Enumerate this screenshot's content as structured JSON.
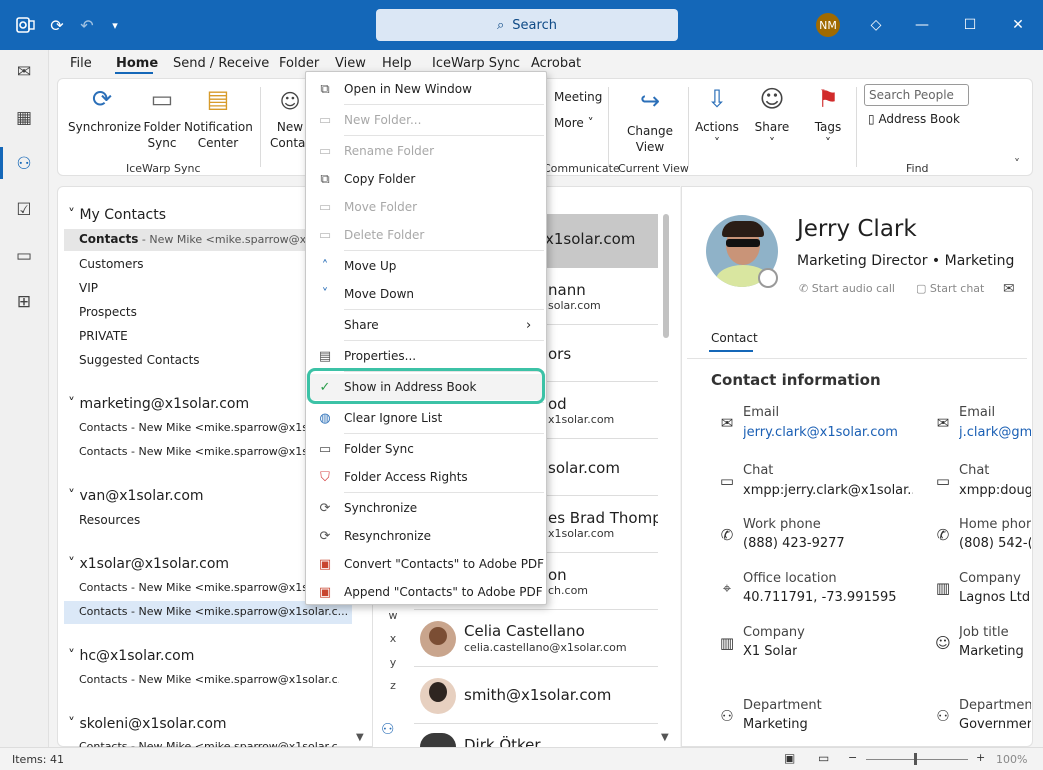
{
  "titlebar": {
    "search_placeholder": "Search",
    "user_initials": "NM"
  },
  "tabs": [
    "File",
    "Home",
    "Send / Receive",
    "Folder",
    "View",
    "Help",
    "IceWarp Sync",
    "Acrobat"
  ],
  "ribbon": {
    "synchronize": "Synchronize",
    "folder_sync_1": "Folder",
    "folder_sync_2": "Sync",
    "notif_1": "Notification",
    "notif_2": "Center",
    "icewarp_group": "IceWarp Sync",
    "new_contact_1": "New",
    "new_contact_2": "Contact",
    "meeting": "Meeting",
    "more": "More",
    "communicate": "Communicate",
    "change_view_1": "Change",
    "change_view_2": "View",
    "current_view": "Current View",
    "actions": "Actions",
    "share": "Share",
    "tags": "Tags",
    "search_people": "Search People",
    "address_book": "Address Book",
    "find": "Find"
  },
  "nav": {
    "my_contacts": "My Contacts",
    "items": [
      {
        "name": "Contacts",
        "sub": " - New Mike <mike.sparrow@x1solar.com>"
      },
      {
        "name": "Customers"
      },
      {
        "name": "VIP"
      },
      {
        "name": "Prospects"
      },
      {
        "name": "PRIVATE"
      },
      {
        "name": "Suggested Contacts"
      }
    ],
    "acct1": "marketing@x1solar.com",
    "acct1_items": [
      "Contacts - New Mike <mike.sparrow@x1solar.c...",
      "Contacts - New Mike <mike.sparrow@x1solar.c..."
    ],
    "acct2": "van@x1solar.com",
    "acct2_items": [
      "Resources"
    ],
    "acct3": "x1solar@x1solar.com",
    "acct3_items": [
      "Contacts - New Mike <mike.sparrow@x1solar.c...",
      "Contacts - New Mike <mike.sparrow@x1solar.c..."
    ],
    "acct4": "hc@x1solar.com",
    "acct4_items": [
      "Contacts - New Mike <mike.sparrow@x1solar.c..."
    ],
    "acct5": "skoleni@x1solar.com",
    "acct5_items": [
      "Contacts - New Mike <mike.sparrow@x1solar.c..."
    ]
  },
  "list": {
    "rows": [
      {
        "name": "x1solar.com",
        "mail": ""
      },
      {
        "name": "nann",
        "mail": "solar.com"
      },
      {
        "name": "ors",
        "mail": ""
      },
      {
        "name": "od",
        "mail": "x1solar.com"
      },
      {
        "name": "solar.com",
        "mail": ""
      },
      {
        "name": "es Brad Thomp...",
        "mail": "x1solar.com"
      },
      {
        "name": "on",
        "mail": "ch.com"
      },
      {
        "name": "Celia Castellano",
        "mail": "celia.castellano@x1solar.com"
      },
      {
        "name": "smith@x1solar.com",
        "mail": ""
      },
      {
        "name": "Dirk Ötker",
        "mail": ""
      }
    ],
    "alpha": [
      "w",
      "x",
      "y",
      "z"
    ]
  },
  "contact": {
    "name": "Jerry Clark",
    "role": "Marketing Director • Marketing",
    "audio": "Start audio call",
    "chat": "Start chat",
    "tab": "Contact",
    "section": "Contact information",
    "email_label": "Email",
    "email": "jerry.clark@x1solar.com",
    "email2_label": "Email",
    "email2": "j.clark@gm",
    "chat_label": "Chat",
    "chat_value": "xmpp:jerry.clark@x1solar....",
    "chat2_label": "Chat",
    "chat2_value": "xmpp:doug",
    "work_label": "Work phone",
    "work": "(888) 423-9277",
    "home_label": "Home phor",
    "home": "(808) 542-(",
    "office_label": "Office location",
    "office": "40.711791, -73.991595",
    "company2_label": "Company",
    "company2": "Lagnos Ltd",
    "company_label": "Company",
    "company": "X1 Solar",
    "job_label": "Job title",
    "job": "Marketing",
    "dept_label": "Department",
    "dept": "Marketing",
    "dept2_label": "Departmen",
    "dept2": "Governmer"
  },
  "menu": {
    "open_new_window": "Open in New Window",
    "new_folder": "New Folder...",
    "rename_folder": "Rename Folder",
    "copy_folder": "Copy Folder",
    "move_folder": "Move Folder",
    "delete_folder": "Delete Folder",
    "move_up": "Move Up",
    "move_down": "Move Down",
    "share": "Share",
    "properties": "Properties...",
    "show_address_book": "Show in Address Book",
    "clear_ignore": "Clear Ignore List",
    "folder_sync": "Folder Sync",
    "folder_access": "Folder Access Rights",
    "synchronize": "Synchronize",
    "resynchronize": "Resynchronize",
    "convert_pdf": "Convert \"Contacts\" to Adobe PDF",
    "append_pdf": "Append \"Contacts\" to Adobe PDF"
  },
  "status": {
    "items": "Items: 41",
    "zoom": "100%"
  },
  "colors": {
    "titlebar": "#1467b8",
    "highlight": "#3cc2a6",
    "link": "#1a5fb4"
  }
}
